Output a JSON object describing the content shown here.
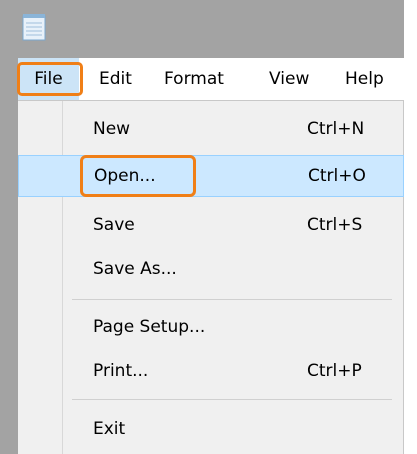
{
  "window": {
    "icon": "notepad-icon",
    "colors": {
      "frame": "#a3a3a3",
      "highlight_outline": "#f07f17",
      "selected_item": "#cce8ff"
    }
  },
  "menubar": {
    "items": [
      {
        "label": "File",
        "active": true
      },
      {
        "label": "Edit"
      },
      {
        "label": "Format"
      },
      {
        "label": "View"
      },
      {
        "label": "Help"
      }
    ]
  },
  "file_menu": {
    "items": [
      {
        "label": "New",
        "shortcut": "Ctrl+N"
      },
      {
        "label": "Open...",
        "shortcut": "Ctrl+O",
        "selected": true
      },
      {
        "label": "Save",
        "shortcut": "Ctrl+S"
      },
      {
        "label": "Save As...",
        "shortcut": ""
      },
      {
        "label": "Page Setup...",
        "shortcut": ""
      },
      {
        "label": "Print...",
        "shortcut": "Ctrl+P"
      },
      {
        "label": "Exit",
        "shortcut": ""
      }
    ]
  }
}
